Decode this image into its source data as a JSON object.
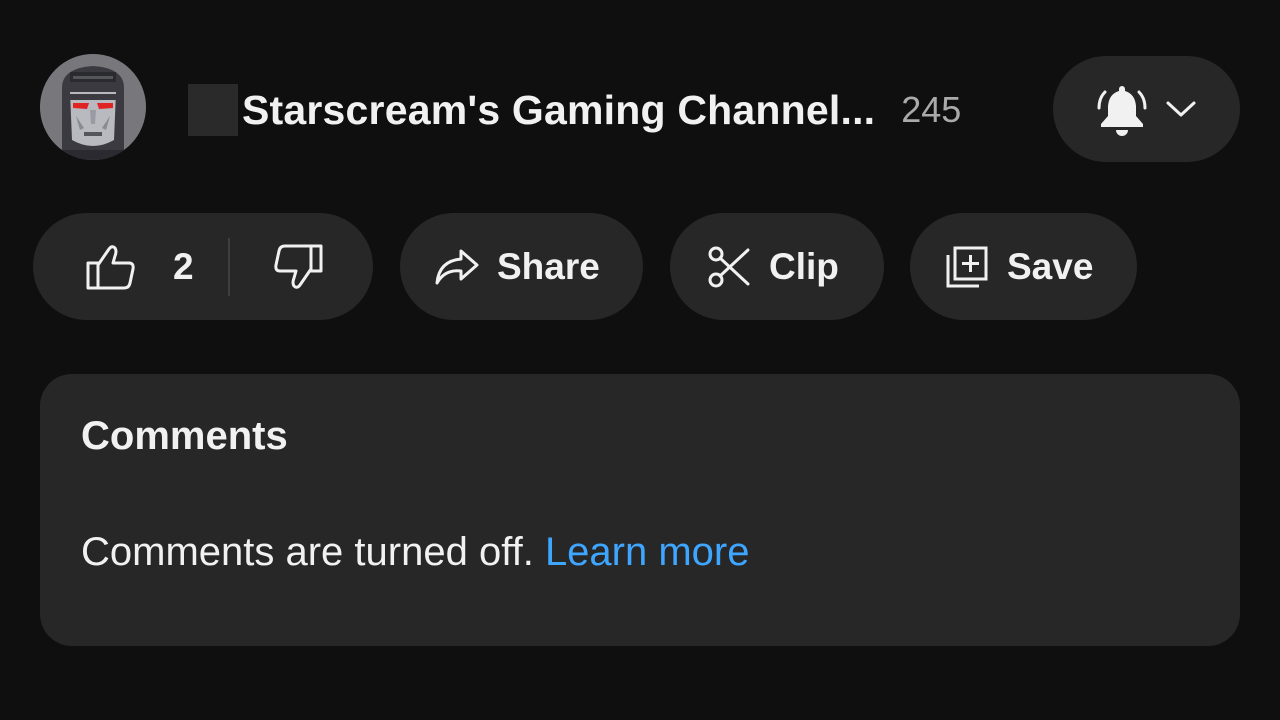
{
  "channel": {
    "name": "Starscream's Gaming Channel...",
    "subscriber_count": "245",
    "avatar_icon": "starscream-robot-avatar",
    "notification_icon": "bell-icon",
    "dropdown_icon": "chevron-down-icon"
  },
  "actions": {
    "like_count": "2",
    "like_icon": "thumbs-up-icon",
    "dislike_icon": "thumbs-down-icon",
    "share_label": "Share",
    "share_icon": "share-arrow-icon",
    "clip_label": "Clip",
    "clip_icon": "scissors-icon",
    "save_label": "Save",
    "save_icon": "playlist-add-icon"
  },
  "comments": {
    "title": "Comments",
    "status_text": "Comments are turned off.",
    "learn_more_label": "Learn more"
  },
  "colors": {
    "background": "#0f0f0f",
    "surface": "#272727",
    "text_primary": "#f1f1f1",
    "text_secondary": "#aaaaaa",
    "link": "#3ea6ff",
    "avatar_eyes": "#e02424"
  }
}
